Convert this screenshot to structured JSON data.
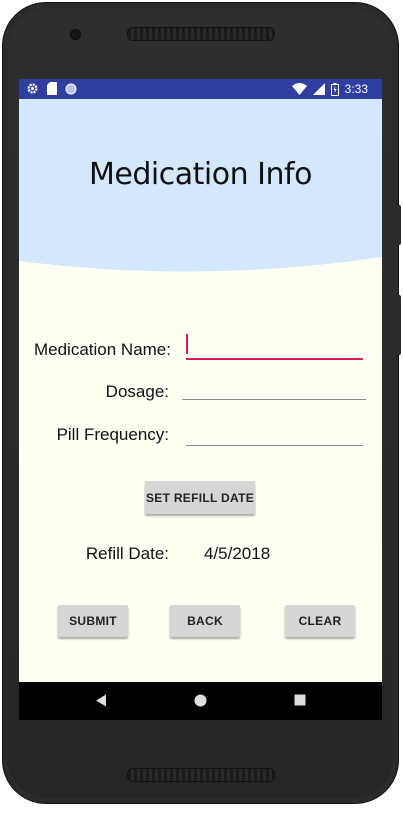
{
  "statusbar": {
    "time": "3:33"
  },
  "header": {
    "title": "Medication Info"
  },
  "form": {
    "name_label": "Medication Name:",
    "name_value": "",
    "dosage_label": "Dosage:",
    "dosage_value": "",
    "frequency_label": "Pill Frequency:",
    "frequency_value": ""
  },
  "refill": {
    "set_button": "SET REFILL DATE",
    "date_label": "Refill Date:",
    "date_value": "4/5/2018"
  },
  "actions": {
    "submit": "SUBMIT",
    "back": "BACK",
    "clear": "CLEAR"
  },
  "colors": {
    "statusbar": "#303f9f",
    "header": "#d4e8fd",
    "accent": "#d81b60",
    "background": "#fffff3"
  },
  "icons": {
    "status_left": [
      "gear-icon",
      "sd-card-icon",
      "circle-icon"
    ],
    "status_right": [
      "wifi-icon",
      "signal-icon",
      "battery-icon"
    ],
    "nav": [
      "back-icon",
      "home-icon",
      "recents-icon"
    ]
  }
}
